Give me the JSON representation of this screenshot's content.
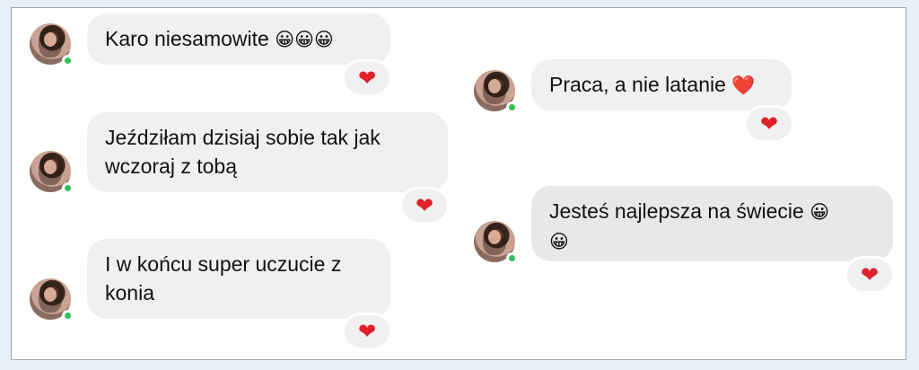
{
  "colors": {
    "bubble": "#f0f0f0",
    "heart": "#e0202a",
    "online": "#33c15a",
    "background": "#e7f0f5"
  },
  "messages": [
    {
      "text": "Karo niesamowite",
      "emoji": "😀😀😀",
      "reaction": "❤"
    },
    {
      "text": "Jeździłam dzisiaj sobie tak jak wczoraj z tobą",
      "reaction": "❤"
    },
    {
      "text": "I w końcu super uczucie z konia",
      "reaction": "❤"
    },
    {
      "text": "Praca, a nie latanie",
      "emoji": "❤️",
      "reaction": "❤"
    },
    {
      "text": "Jesteś najlepsza na świecie",
      "emoji": "😀",
      "emoji2": "😀",
      "reaction": "❤"
    }
  ],
  "icons": {
    "avatar": "profile-photo",
    "online": "online-dot-icon",
    "reaction": "heart-icon"
  }
}
